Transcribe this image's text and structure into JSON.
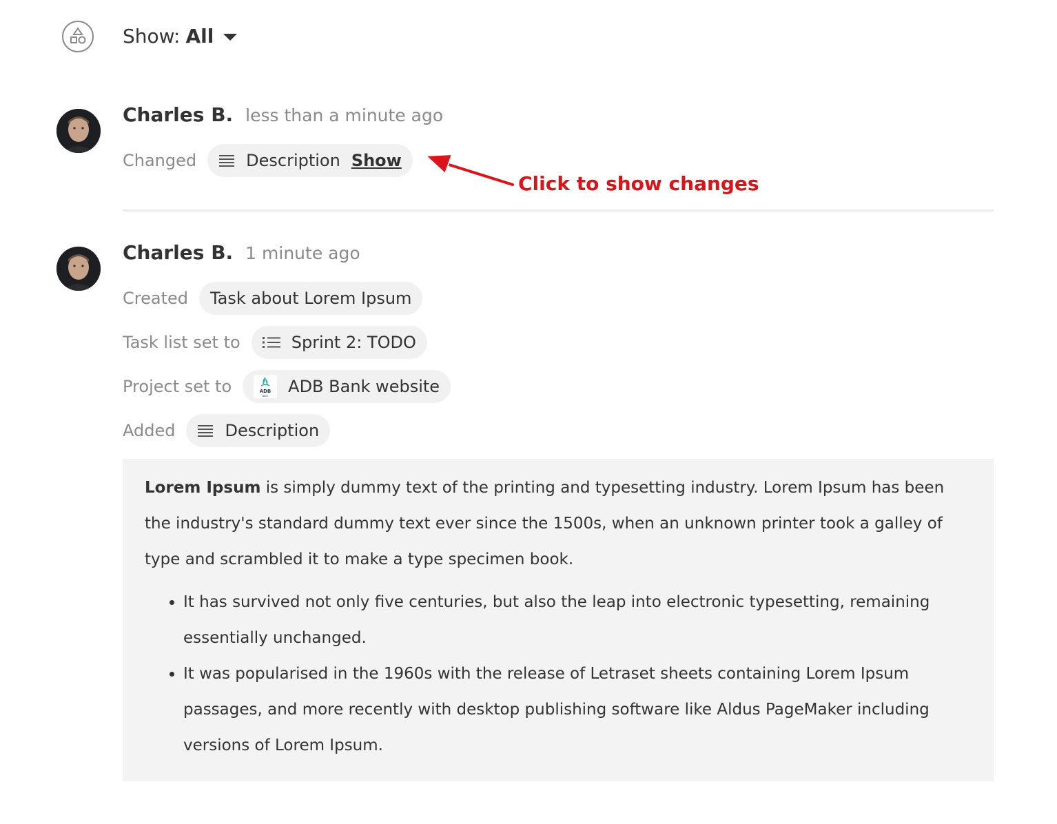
{
  "filter": {
    "label": "Show:",
    "value": "All",
    "icon": "shapes-icon"
  },
  "entries": [
    {
      "author": "Charles B.",
      "time": "less than a minute ago",
      "rows": [
        {
          "label": "Changed",
          "chip": {
            "icon": "text-lines-icon",
            "text": "Description",
            "link": "Show"
          }
        }
      ]
    },
    {
      "author": "Charles B.",
      "time": "1 minute ago",
      "rows": [
        {
          "label": "Created",
          "chip": {
            "text": "Task about Lorem Ipsum"
          }
        },
        {
          "label": "Task list set to",
          "chip": {
            "icon": "list-icon",
            "text": "Sprint 2: TODO"
          }
        },
        {
          "label": "Project set to",
          "chip": {
            "icon": "adb-bank-logo",
            "logo_text": "ADB",
            "logo_subtext": "Bank",
            "text": "ADB Bank website"
          }
        },
        {
          "label": "Added",
          "chip": {
            "icon": "text-lines-icon",
            "text": "Description"
          }
        }
      ],
      "description": {
        "lead_bold": "Lorem Ipsum",
        "lead_rest": " is simply dummy text of the printing and typesetting industry. Lorem Ipsum has been the industry's standard dummy text ever since the 1500s, when an unknown printer took a galley of type and scrambled it to make a type specimen book.",
        "bullets": [
          "It has survived not only five centuries, but also the leap into electronic typesetting, remaining essentially unchanged.",
          "It was popularised in the 1960s with the release of Letraset sheets containing Lorem Ipsum passages, and more recently with desktop publishing software like Aldus PageMaker including versions of Lorem Ipsum."
        ]
      }
    }
  ],
  "annotation": {
    "text": "Click to show changes",
    "color": "#d9141b"
  }
}
